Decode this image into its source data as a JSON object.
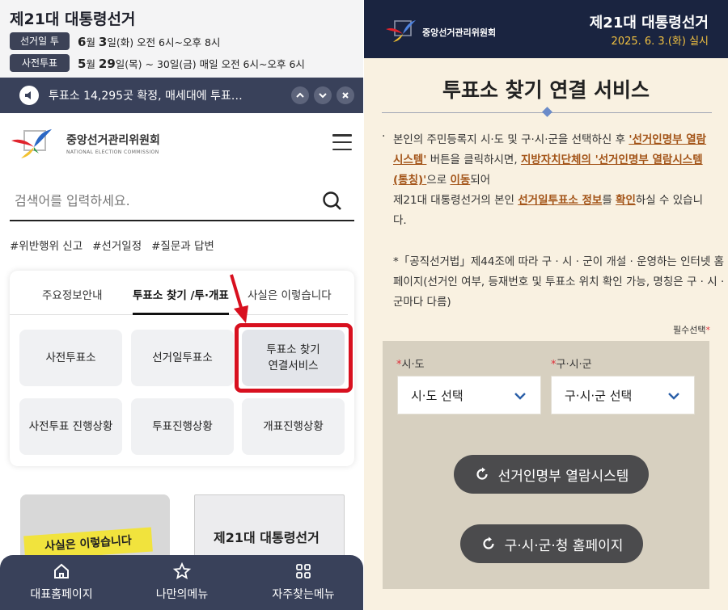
{
  "left": {
    "election": {
      "title": "제21대 대통령선거",
      "schedule": [
        {
          "badge": "선거일 투표",
          "text_pre": "",
          "day1": "6",
          "t1": "월 ",
          "day2": "3",
          "t2": "일(화) 오전 6시~오후 8시"
        },
        {
          "badge": "사전투표",
          "text_pre": "",
          "day1": "5",
          "t1": "월 ",
          "day2": "29",
          "t2": "일(목) ~ 30일(금) 매일 오전 6시~오후 6시"
        }
      ]
    },
    "news": {
      "text": "투표소 14,295곳 확정, 매세대에 투표…",
      "icons": [
        "speaker-icon",
        "chevron-up-icon",
        "chevron-down-icon",
        "close-icon"
      ]
    },
    "logo": {
      "name_ko": "중앙선거관리위원회",
      "name_en": "NATIONAL ELECTION COMMISSION"
    },
    "search": {
      "placeholder": "검색어를 입력하세요."
    },
    "hashtags": [
      "#위반행위 신고",
      "#선거일정",
      "#질문과 답변"
    ],
    "menu": {
      "tabs": [
        "주요정보안내",
        "투표소 찾기 /투·개표",
        "사실은 이렇습니다"
      ],
      "active_tab": 1,
      "tiles": [
        [
          "사전투표소",
          "선거일투표소",
          "투표소 찾기",
          "연결서비스"
        ],
        [
          "사전투표 진행상황",
          "투표진행상황",
          "개표진행상황"
        ]
      ]
    },
    "thumbs": {
      "card1_label": "사실은 이렇습니다",
      "card2_title": "제21대 대통령선거"
    },
    "bottom_nav": [
      "대표홈페이지",
      "나만의메뉴",
      "자주찾는메뉴"
    ],
    "highlight_color": "#d8101f"
  },
  "right": {
    "header": {
      "org": "중앙선거관리위원회",
      "title": "제21대 대통령선거",
      "date": "2025. 6. 3.(화) 실시"
    },
    "heading": "투표소 찾기 연결 서비스",
    "body": {
      "p1": "본인의 주민등록지 시·도 및 구·시·군을 선택하신 후 ",
      "u1": "'선거인명부 열람시스템'",
      "p2": " 버튼을 클릭하시면, ",
      "u2": "지방자치단체의 '선거인명부 열람시스템(통칭)'",
      "p3": "으로 ",
      "u3": "이동",
      "p4": "되어",
      "p5": "제21대 대통령선거의 본인 ",
      "u4": "선거일투표소 정보",
      "p6": "를 ",
      "u5": "확인",
      "p7": "하실 수 있습니다."
    },
    "note": "*「공직선거법」제44조에 따라 구 · 시 · 군이 개설 · 운영하는 인터넷 홈페이지(선거인 여부, 등재번호 및 투표소 위치 확인 가능, 명칭은 구 · 시 · 군마다 다름)",
    "required": "필수선택",
    "form": {
      "sido_label": "시·도",
      "sido_value": "시·도 선택",
      "gusigun_label": "구·시·군",
      "gusigun_value": "구·시·군 선택",
      "btn1": "선거인명부 열람시스템",
      "btn2": "구·시·군·청 홈페이지"
    }
  }
}
